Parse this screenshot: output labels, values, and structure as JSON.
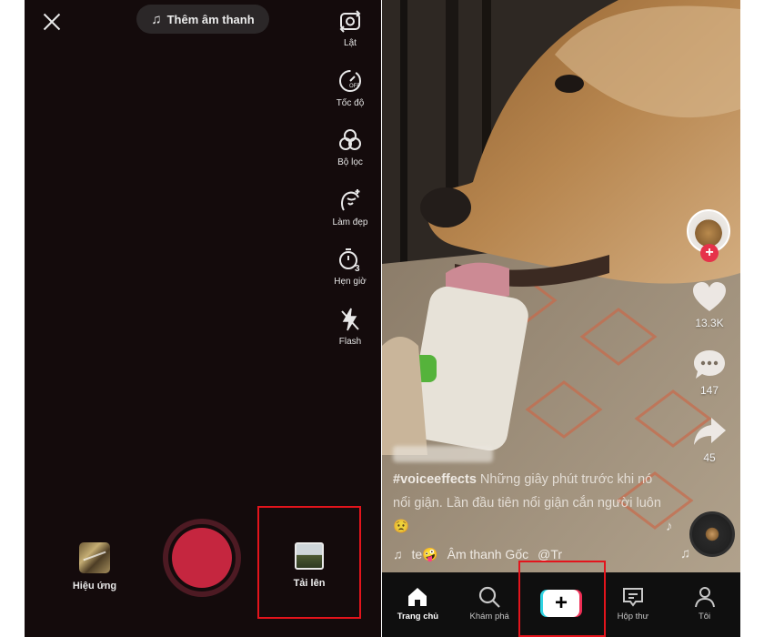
{
  "camera": {
    "add_sound": "Thêm âm thanh",
    "tools": [
      {
        "label": "Lật",
        "icon": "flip-camera-icon"
      },
      {
        "label": "Tốc độ",
        "icon": "speed-icon"
      },
      {
        "label": "Bộ lọc",
        "icon": "filters-icon"
      },
      {
        "label": "Làm đẹp",
        "icon": "beautify-icon"
      },
      {
        "label": "Hẹn giờ",
        "icon": "timer-icon"
      },
      {
        "label": "Flash",
        "icon": "flash-off-icon"
      }
    ],
    "effects_label": "Hiệu ứng",
    "upload_label": "Tải lên",
    "highlight_color": "#e3141c",
    "record_color": "#c5263f"
  },
  "feed": {
    "caption_hashtag": "#voiceeffects",
    "caption_text": "Những giây phút trước khi nó nổi giận. Lần đầu tiên nổi giận cắn người luôn 😟",
    "sound_prefix": "te🤪",
    "sound_name": "Âm thanh Gốc",
    "sound_suffix": "@Tr",
    "likes": "13.3K",
    "comments": "147",
    "shares": "45",
    "nav": [
      {
        "label": "Trang chủ",
        "icon": "home-icon"
      },
      {
        "label": "Khám phá",
        "icon": "search-icon"
      },
      {
        "label": "",
        "icon": "create-plus-icon"
      },
      {
        "label": "Hộp thư",
        "icon": "inbox-icon"
      },
      {
        "label": "Tôi",
        "icon": "profile-icon"
      }
    ]
  }
}
